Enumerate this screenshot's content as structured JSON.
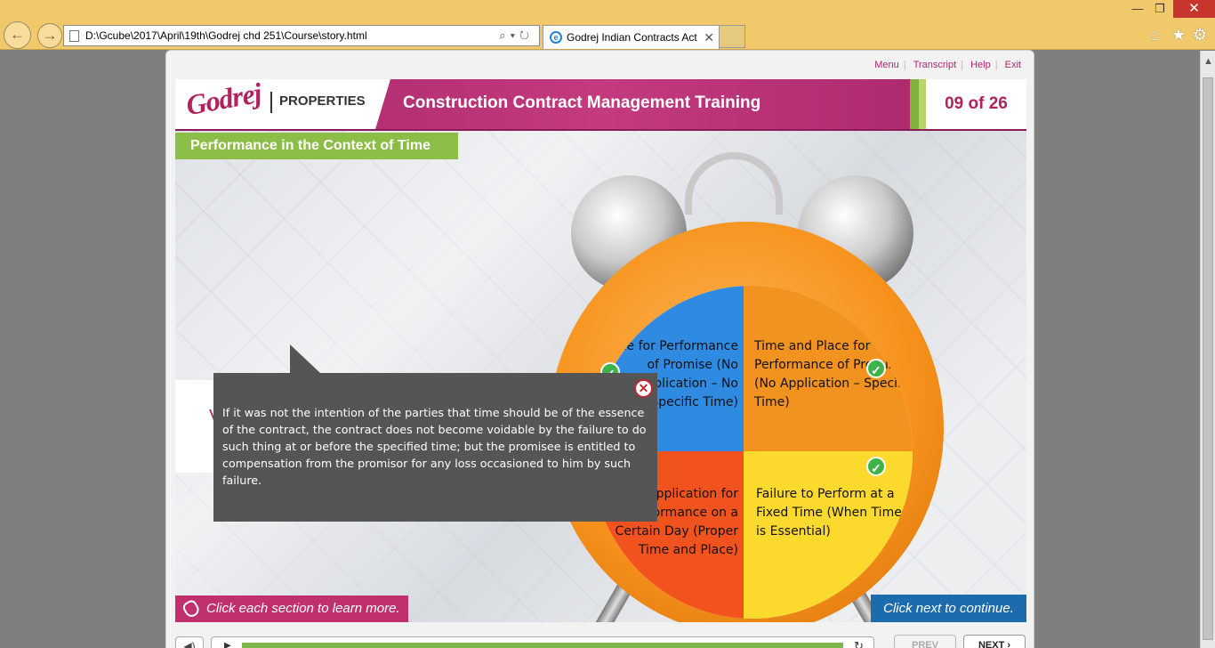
{
  "browser": {
    "address": "D:\\Gcube\\2017\\April\\19th\\Godrej chd 251\\Course\\story.html",
    "tab_title": "Godrej Indian Contracts Act"
  },
  "player": {
    "menu": [
      "Menu",
      "Transcript",
      "Help",
      "Exit"
    ],
    "logo_script": "Godrej",
    "logo_text": "PROPERTIES",
    "course_title": "Construction Contract Management Training",
    "page_indicator": "09 of 26",
    "section_title": "Performance in the Context of Time",
    "quadrants": {
      "top_left": "Time for Performance of Promise (No Application – No Specific Time)",
      "top_right": "Time and Place for Performance of Promise (No Application – Specific Time)",
      "bottom_left": "Application for Performance on a Certain Day (Proper Time and Place)",
      "bottom_right": "Failure to Perform at a Fixed Time (When Time is Essential)"
    },
    "left_card_text": "V",
    "callout_text": "If it was not the intention of the parties that time should be of the essence of the contract, the contract does not become voidable by the failure to do such thing at or before the specified time; but the promisee is entitled to compensation from the promisor for any loss occasioned to him by such failure.",
    "hint_left": "Click each section to learn more.",
    "hint_right": "Click next to continue.",
    "prev_label": "PREV",
    "next_label": "NEXT ›"
  },
  "colors": {
    "brand_magenta": "#b0235f",
    "header_green": "#8cbd46",
    "quad_blue": "#2f8ae2",
    "quad_orange": "#f2921f",
    "quad_red": "#f2531e",
    "quad_yellow": "#fcd92d"
  }
}
